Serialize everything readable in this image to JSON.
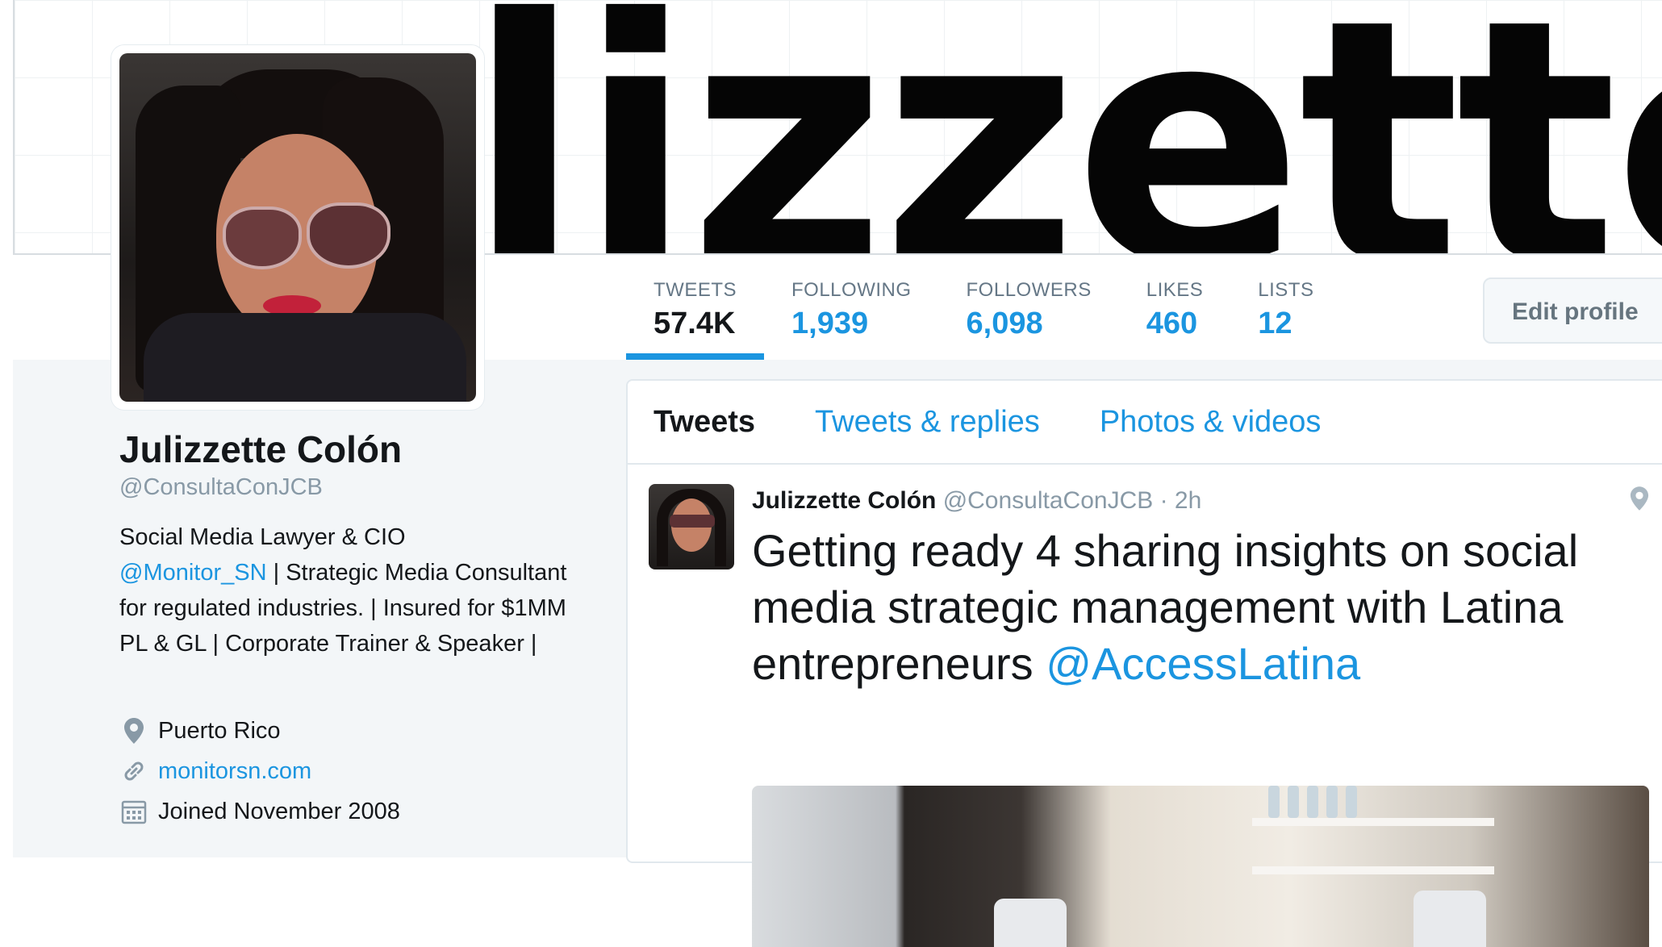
{
  "banner": {
    "text": "lizzettel"
  },
  "profile": {
    "name": "Julizzette Colón",
    "handle": "@ConsultaConJCB",
    "bio": {
      "line1": "Social Media Lawyer & CIO",
      "mention": "@Monitor_SN",
      "rest": " | Strategic Media Consultant for regulated industries. | Insured for $1MM PL & GL | Corporate Trainer & Speaker |"
    },
    "location": "Puerto Rico",
    "website": "monitorsn.com",
    "joined": "Joined November 2008"
  },
  "stats": [
    {
      "label": "TWEETS",
      "value": "57.4K"
    },
    {
      "label": "FOLLOWING",
      "value": "1,939"
    },
    {
      "label": "FOLLOWERS",
      "value": "6,098"
    },
    {
      "label": "LIKES",
      "value": "460"
    },
    {
      "label": "LISTS",
      "value": "12"
    }
  ],
  "edit_profile_label": "Edit profile",
  "tabs": [
    {
      "label": "Tweets"
    },
    {
      "label": "Tweets & replies"
    },
    {
      "label": "Photos & videos"
    }
  ],
  "tweet": {
    "name": "Julizzette Colón",
    "handle": "@ConsultaConJCB",
    "time": "· 2h",
    "text": "Getting ready 4 sharing insights on social media strategic management with Latina entrepreneurs ",
    "mention": "@AccessLatina"
  },
  "colors": {
    "accent": "#1b95e0",
    "text": "#14171a",
    "muted": "#8899a6"
  },
  "icons": {
    "location": "map-pin-icon",
    "website": "link-icon",
    "joined": "calendar-icon",
    "tweet_location": "map-pin-icon"
  }
}
